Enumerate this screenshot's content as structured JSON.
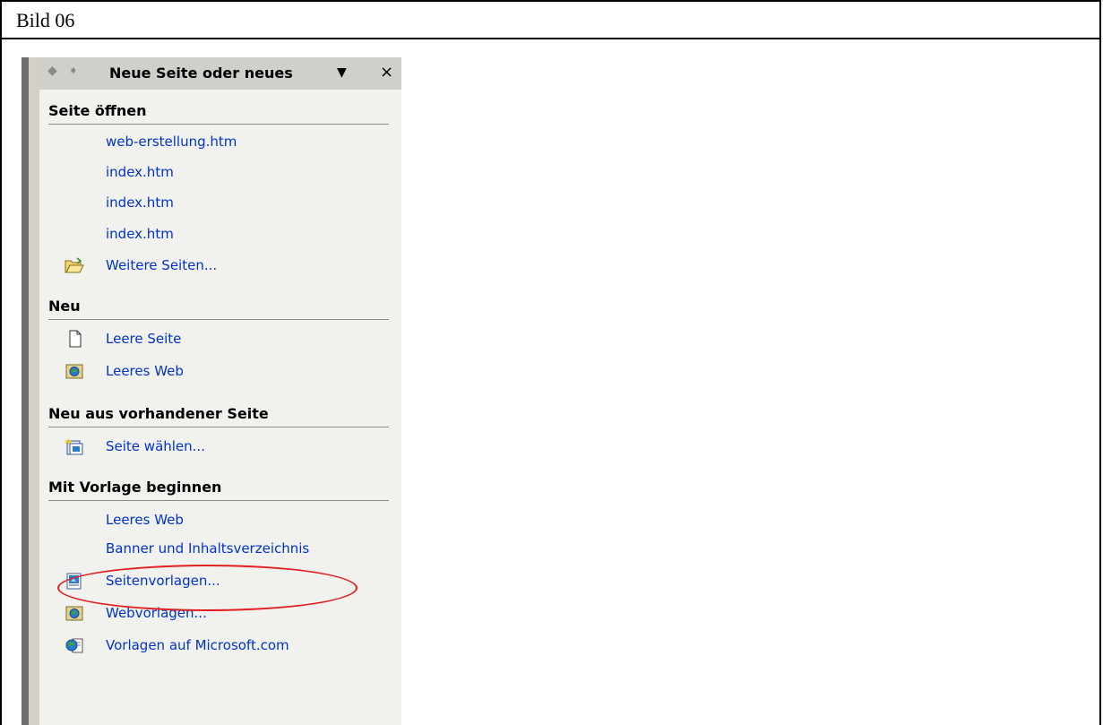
{
  "caption": "Bild 06",
  "pane": {
    "title": "Neue Seite oder neues",
    "dropdown_icon": "triangle-down",
    "close_label": "×"
  },
  "sections": {
    "open": {
      "header": "Seite öffnen",
      "items": [
        "web-erstellung.htm",
        "index.htm",
        "index.htm",
        "index.htm"
      ],
      "more": "Weitere Seiten..."
    },
    "new": {
      "header": "Neu",
      "blank_page": "Leere Seite",
      "blank_web": "Leeres Web"
    },
    "from_existing": {
      "header": "Neu aus vorhandener Seite",
      "choose": "Seite wählen..."
    },
    "template": {
      "header": "Mit Vorlage beginnen",
      "blank_web": "Leeres Web",
      "banner_toc": "Banner und Inhaltsverzeichnis",
      "page_templates": "Seitenvorlagen...",
      "web_templates": "Webvorlagen...",
      "ms_templates": "Vorlagen auf Microsoft.com"
    }
  },
  "colors": {
    "link": "#0033cc",
    "highlight_oval": "#e02020",
    "pane_bg": "#f1f1ed"
  }
}
